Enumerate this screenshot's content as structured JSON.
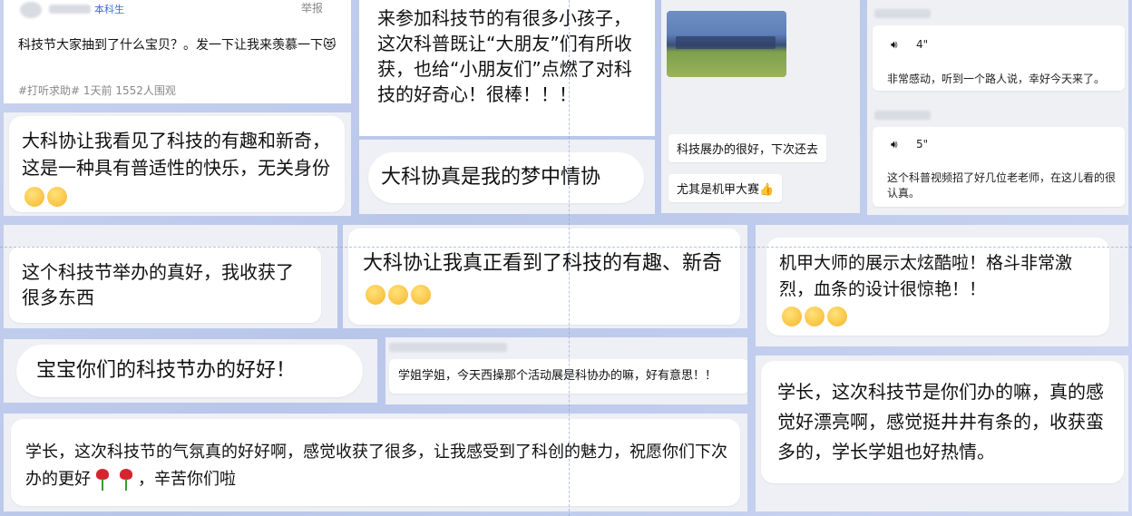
{
  "post": {
    "user_tag": "本科生",
    "report": "举报",
    "title": "科技节大家抽到了什么宝贝？。发一下让我来羡慕一下😻",
    "meta": "#打听求助# 1天前 1552人围观"
  },
  "messages": {
    "m1": "大科协让我看见了科技的有趣和新奇，这是一种具有普适性的快乐，无关身份",
    "m2": "来参加科技节的有很多小孩子，这次科普既让“大朋友”们有所收获，也给“小朋友们”点燃了对科技的好奇心！很棒！！！",
    "m3": "大科协真是我的梦中情协",
    "m4_a": "科技展办的很好，下次还去",
    "m4_b": "尤其是机甲大赛👍",
    "voice1_len": "4\"",
    "voice1_text": "非常感动，听到一个路人说，幸好今天来了。",
    "voice2_len": "5\"",
    "voice2_text": "这个科普视频招了好几位老老师，在这儿看的很认真。",
    "m5": "这个科技节举办的真好，我收获了很多东西",
    "m6": "大科协让我真正看到了科技的有趣、新奇",
    "m7": "机甲大师的展示太炫酷啦！格斗非常激烈，血条的设计很惊艳！！",
    "m8": "宝宝你们的科技节办的好好！",
    "m9": "学姐学姐，今天西操那个活动展是科协办的嘛，好有意思！！",
    "m10_a": "学长，这次科技节的气氛真的好好啊，感觉收获了很多，让我感受到了科创的魅力，祝愿你们下次办的更好",
    "m10_b": "，辛苦你们啦",
    "m11": "学长，这次科技节是你们办的嘛，真的感觉好漂亮啊，感觉挺井井有条的，收获蛮多的，学长学姐也好热情。"
  },
  "icons": {
    "emoji": "smiling-face-icon",
    "rose": "rose-icon",
    "voice": "voice-message-icon",
    "avatar": "avatar"
  }
}
